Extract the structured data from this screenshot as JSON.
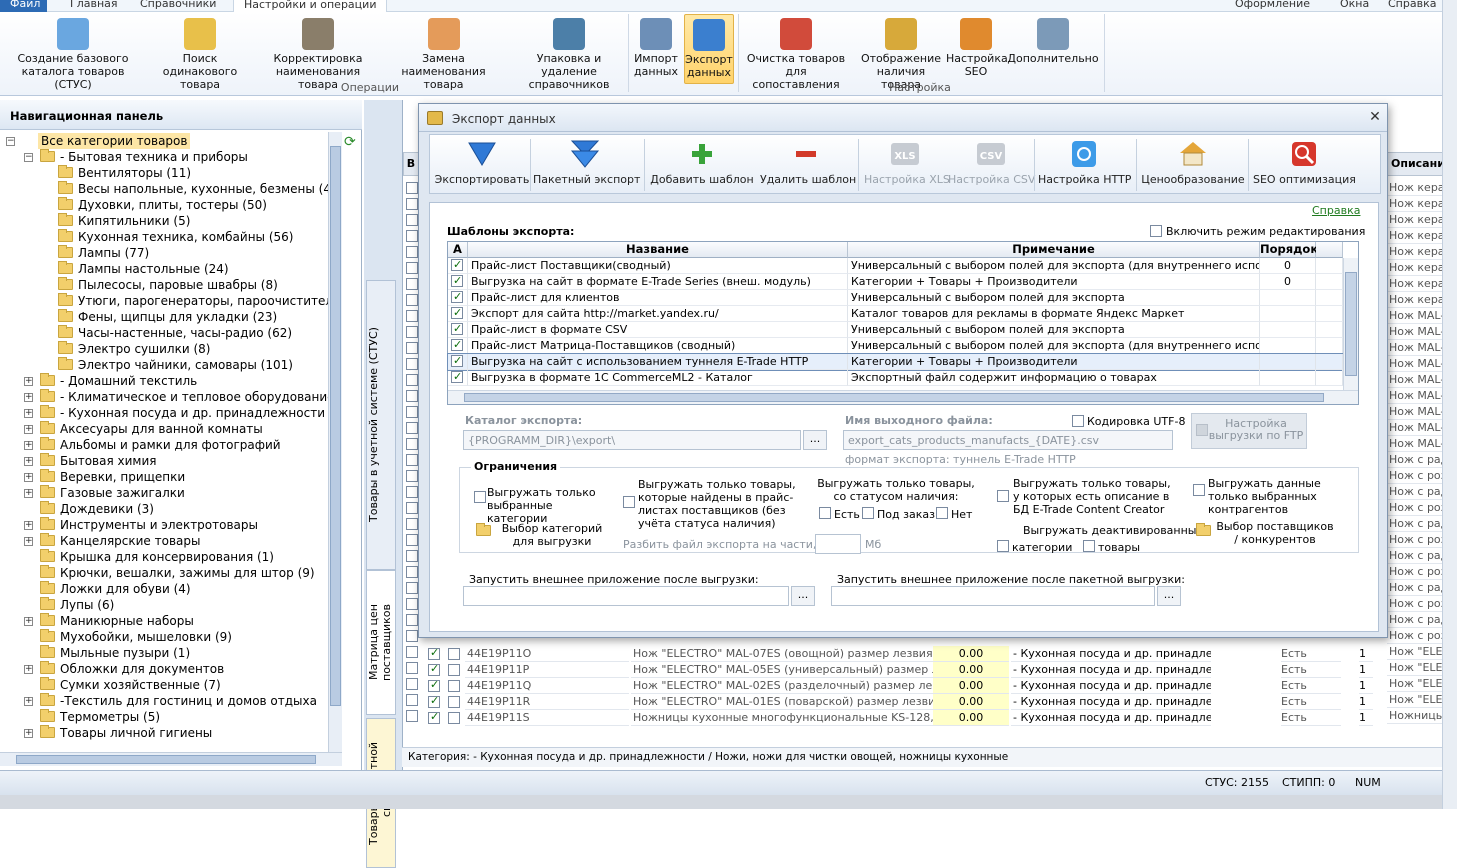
{
  "ribbon": {
    "tabs": [
      "Файл",
      "Главная",
      "Справочники",
      "Настройки и операции"
    ],
    "right_items": [
      "Оформление",
      "Окна",
      "Справка"
    ],
    "buttons": [
      {
        "label": "Создание базового каталога товаров (СТУС)",
        "icon": "cubes-icon"
      },
      {
        "label": "Поиск одинакового товара",
        "icon": "search-star-icon"
      },
      {
        "label": "Корректировка наименования товара",
        "icon": "book-icon"
      },
      {
        "label": "Замена наименования товара",
        "icon": "replace-icon"
      },
      {
        "label": "Упаковка и удаление справочников",
        "icon": "database-icon"
      },
      {
        "label": "Импорт данных",
        "icon": "import-icon"
      },
      {
        "label": "Экспорт данных",
        "icon": "export-icon"
      },
      {
        "label": "Очистка товаров для сопоставления",
        "icon": "tools-icon"
      },
      {
        "label": "Отображение наличия товара",
        "icon": "pencil-icon"
      },
      {
        "label": "Настройка SEO",
        "icon": "seo-icon"
      },
      {
        "label": "Дополнительно",
        "icon": "document-icon"
      }
    ],
    "groups": [
      "Операции",
      "Настройка"
    ]
  },
  "nav": {
    "title": "Навигационная панель",
    "items": [
      {
        "label": "Все категории товаров",
        "level": 0,
        "exp": "-",
        "root": true
      },
      {
        "label": "- Бытовая техника и приборы",
        "level": 1,
        "exp": "-"
      },
      {
        "label": "Вентиляторы (11)",
        "level": 2,
        "exp": ""
      },
      {
        "label": "Весы напольные, кухонные, безмены (45)",
        "level": 2,
        "exp": ""
      },
      {
        "label": "Духовки, плиты, тостеры (50)",
        "level": 2,
        "exp": ""
      },
      {
        "label": "Кипятильники (5)",
        "level": 2,
        "exp": ""
      },
      {
        "label": "Кухонная техника, комбайны (56)",
        "level": 2,
        "exp": ""
      },
      {
        "label": "Лампы (77)",
        "level": 2,
        "exp": ""
      },
      {
        "label": "Лампы настольные (24)",
        "level": 2,
        "exp": ""
      },
      {
        "label": "Пылесосы, паровые швабры (8)",
        "level": 2,
        "exp": ""
      },
      {
        "label": "Утюги, парогенераторы, пароочистители (",
        "level": 2,
        "exp": ""
      },
      {
        "label": "Фены, щипцы для укладки (23)",
        "level": 2,
        "exp": ""
      },
      {
        "label": "Часы-настенные, часы-радио (62)",
        "level": 2,
        "exp": ""
      },
      {
        "label": "Электро сушилки (8)",
        "level": 2,
        "exp": ""
      },
      {
        "label": "Электро чайники, самовары (101)",
        "level": 2,
        "exp": ""
      },
      {
        "label": "- Домашний текстиль",
        "level": 1,
        "exp": "+"
      },
      {
        "label": "- Климатическое и тепловое оборудование",
        "level": 1,
        "exp": "+"
      },
      {
        "label": "- Кухонная посуда и др. принадлежности",
        "level": 1,
        "exp": "+"
      },
      {
        "label": "Аксесуары для ванной комнаты",
        "level": 1,
        "exp": "+"
      },
      {
        "label": "Альбомы и рамки для фотографий",
        "level": 1,
        "exp": "+"
      },
      {
        "label": "Бытовая химия",
        "level": 1,
        "exp": "+"
      },
      {
        "label": "Веревки, прищепки",
        "level": 1,
        "exp": "+"
      },
      {
        "label": "Газовые зажигалки",
        "level": 1,
        "exp": "+"
      },
      {
        "label": "Дождевики (3)",
        "level": 1,
        "exp": ""
      },
      {
        "label": "Инструменты и электротовары",
        "level": 1,
        "exp": "+"
      },
      {
        "label": "Канцелярские товары",
        "level": 1,
        "exp": "+"
      },
      {
        "label": "Крышка для консервирования (1)",
        "level": 1,
        "exp": ""
      },
      {
        "label": "Крючки, вешалки, зажимы для штор (9)",
        "level": 1,
        "exp": ""
      },
      {
        "label": "Ложки для обуви (4)",
        "level": 1,
        "exp": ""
      },
      {
        "label": "Лупы (6)",
        "level": 1,
        "exp": ""
      },
      {
        "label": "Маникюрные наборы",
        "level": 1,
        "exp": "+"
      },
      {
        "label": "Мухобойки, мышеловки (9)",
        "level": 1,
        "exp": ""
      },
      {
        "label": "Мыльные пузыри (1)",
        "level": 1,
        "exp": ""
      },
      {
        "label": "Обложки для документов",
        "level": 1,
        "exp": "+"
      },
      {
        "label": "Сумки хозяйственные (7)",
        "level": 1,
        "exp": ""
      },
      {
        "label": "-Текстиль для гостиниц и домов отдыха",
        "level": 1,
        "exp": "+"
      },
      {
        "label": "Термометры (5)",
        "level": 1,
        "exp": ""
      },
      {
        "label": "Товары личной гигиены",
        "level": 1,
        "exp": "+"
      }
    ]
  },
  "vtabs": [
    "Товары в учетной системе (СТУС)",
    "Матрица цен поставщиков",
    "Товары в учетной системе"
  ],
  "grid": {
    "col_b": "В",
    "col_desc": "Описание",
    "desc_cells": [
      "Нож керам",
      "Нож керам",
      "Нож керам",
      "Нож керам",
      "Нож керам",
      "Нож керам",
      "Нож керам",
      "Нож керам",
      "Нож MAL-0",
      "Нож MAL-0",
      "Нож MAL-0",
      "Нож MAL-0",
      "Нож MAL-0",
      "Нож MAL-0",
      "Нож MAL-0",
      "Нож MAL-0",
      "Нож MAL-0",
      "Нож с раду",
      "Нож с розо",
      "Нож с раду",
      "Нож с розо",
      "Нож с раду",
      "Нож с розо",
      "Нож с раду",
      "Нож с розо",
      "Нож с раду",
      "Нож с розо",
      "Нож с раду",
      "Нож с розо",
      "Нож \"ELECT",
      "Нож \"ELECT",
      "Нож \"ELECT",
      "Нож \"ELECT",
      "Ножницы к"
    ],
    "rows": [
      {
        "code": "44E19P11O",
        "name": "Нож \"ELECTRO\" MAL-07ES (овощной) размер лезвия 7,5 см",
        "price": "0.00",
        "cat": "- Кухонная посуда и др. принадлежнос",
        "avail": "Есть",
        "qty": "1",
        "desc": "Нож \"ELECT"
      },
      {
        "code": "44E19P11P",
        "name": "Нож \"ELECTRO\" MAL-05ES (универсальный) размер лезвия 1",
        "price": "0.00",
        "cat": "- Кухонная посуда и др. принадлежнос",
        "avail": "Есть",
        "qty": "1",
        "desc": "Нож \"ELECT"
      },
      {
        "code": "44E19P11Q",
        "name": "Нож \"ELECTRO\" MAL-02ES (разделочный) размер лезвия 20",
        "price": "0.00",
        "cat": "- Кухонная посуда и др. принадлежнос",
        "avail": "Есть",
        "qty": "1",
        "desc": "Нож \"ELECT"
      },
      {
        "code": "44E19P11R",
        "name": "Нож \"ELECTRO\" MAL-01ES (поварской) размер лезвия 20 см",
        "price": "0.00",
        "cat": "- Кухонная посуда и др. принадлежнос",
        "avail": "Есть",
        "qty": "1",
        "desc": "Нож \"ELECT"
      },
      {
        "code": "44E19P11S",
        "name": "Ножницы кухонные многофункциональные KS-128, 22,8 см",
        "price": "0.00",
        "cat": "- Кухонная посуда и др. принадлежнос",
        "avail": "Есть",
        "qty": "1",
        "desc": "Ножницы к"
      }
    ],
    "category_path": "Категория: - Кухонная посуда и др. принадлежности / Ножи, ножи для чистки овощей, ножницы кухонные"
  },
  "status": {
    "stus": "СТУС: 2155",
    "stipp": "СТИПП: 0",
    "num": "NUM"
  },
  "dialog": {
    "title": "Экспорт данных",
    "toolbar": [
      {
        "label": "Экспортировать",
        "icon": "funnel-icon",
        "disabled": false
      },
      {
        "label": "Пакетный экспорт",
        "icon": "double-funnel-icon",
        "disabled": false
      },
      {
        "label": "Добавить шаблон",
        "icon": "plus-icon",
        "disabled": false,
        "dropdown": true
      },
      {
        "label": "Удалить шаблон",
        "icon": "minus-icon",
        "disabled": false
      },
      {
        "label": "Настройка XLS",
        "icon": "xls-icon",
        "disabled": true
      },
      {
        "label": "Настройка CSV",
        "icon": "csv-icon",
        "disabled": true
      },
      {
        "label": "Настройка HTTP",
        "icon": "http-icon",
        "disabled": false
      },
      {
        "label": "Ценообразование",
        "icon": "house-icon",
        "disabled": false
      },
      {
        "label": "SEO оптимизация",
        "icon": "seo-search-icon",
        "disabled": false
      }
    ],
    "help": "Справка",
    "templates_title": "Шаблоны экспорта:",
    "edit_mode": "Включить режим редактирования",
    "columns": [
      "А",
      "Название",
      "Примечание",
      "Порядок"
    ],
    "rows": [
      {
        "name": "Прайс-лист Поставщики(сводный)",
        "note": "Универсальный с выбором полей для экспорта (для внутреннего использования)",
        "order": "0"
      },
      {
        "name": "Выгрузка на сайт в формате E-Trade Series (внеш. модуль)",
        "note": "Категории + Товары + Производители",
        "order": "0"
      },
      {
        "name": "Прайс-лист для клиентов",
        "note": "Универсальный с выбором полей для экспорта",
        "order": ""
      },
      {
        "name": "Экспорт для сайта http://market.yandex.ru/",
        "note": "Каталог товаров для рекламы в формате Яндекс Маркет",
        "order": ""
      },
      {
        "name": "Прайс-лист в формате CSV",
        "note": "Универсальный с выбором полей для экспорта",
        "order": ""
      },
      {
        "name": "Прайс-лист Матрица-Поставщиков (сводный)",
        "note": "Универсальный с выбором полей для экспорта (для внутреннего использования)",
        "order": ""
      },
      {
        "name": "Выгрузка на сайт с использованием туннеля E-Trade HTTP",
        "note": "Категории + Товары + Производители",
        "order": "",
        "selected": true
      },
      {
        "name": "Выгрузка в формате 1С CommerceML2 - Каталог",
        "note": "Экспортный файл содержит информацию о товарах",
        "order": ""
      }
    ],
    "catalog_label": "Каталог экспорта:",
    "catalog_value": "{PROGRAMM_DIR}\\export\\",
    "output_label": "Имя выходного файла:",
    "output_value": "export_cats_products_manufacts_{DATE}.csv",
    "utf8": "Кодировка UTF-8",
    "ftp": "Настройка выгрузки по FTP",
    "format": "формат экспорта: туннель E-Trade HTTP",
    "limits_title": "Ограничения",
    "only_selected_cats": "Выгружать только выбранные категории",
    "choose_cats": "Выбор категорий для выгрузки",
    "only_found": "Выгружать только товары, которые найдены в прайс-листах поставщиков (без учёта статуса наличия)",
    "split_label": "Разбить файл экспорта на части, по:",
    "split_unit": "Мб",
    "status_label": "Выгружать только товары, со статусом наличия:",
    "st_yes": "Есть",
    "st_order": "Под заказ",
    "st_no": "Нет",
    "only_desc": "Выгружать только товары, у которых есть описание в БД E-Trade Content Creator",
    "deact_label": "Выгружать деактивированные:",
    "deact_cats": "категории",
    "deact_goods": "товары",
    "only_contractors": "Выгружать данные только выбранных контрагентов",
    "choose_suppliers": "Выбор поставщиков / конкурентов",
    "run_after": "Запустить внешнее приложение после выгрузки:",
    "run_after_batch": "Запустить внешнее приложение после пакетной выгрузки:",
    "dots": "..."
  }
}
